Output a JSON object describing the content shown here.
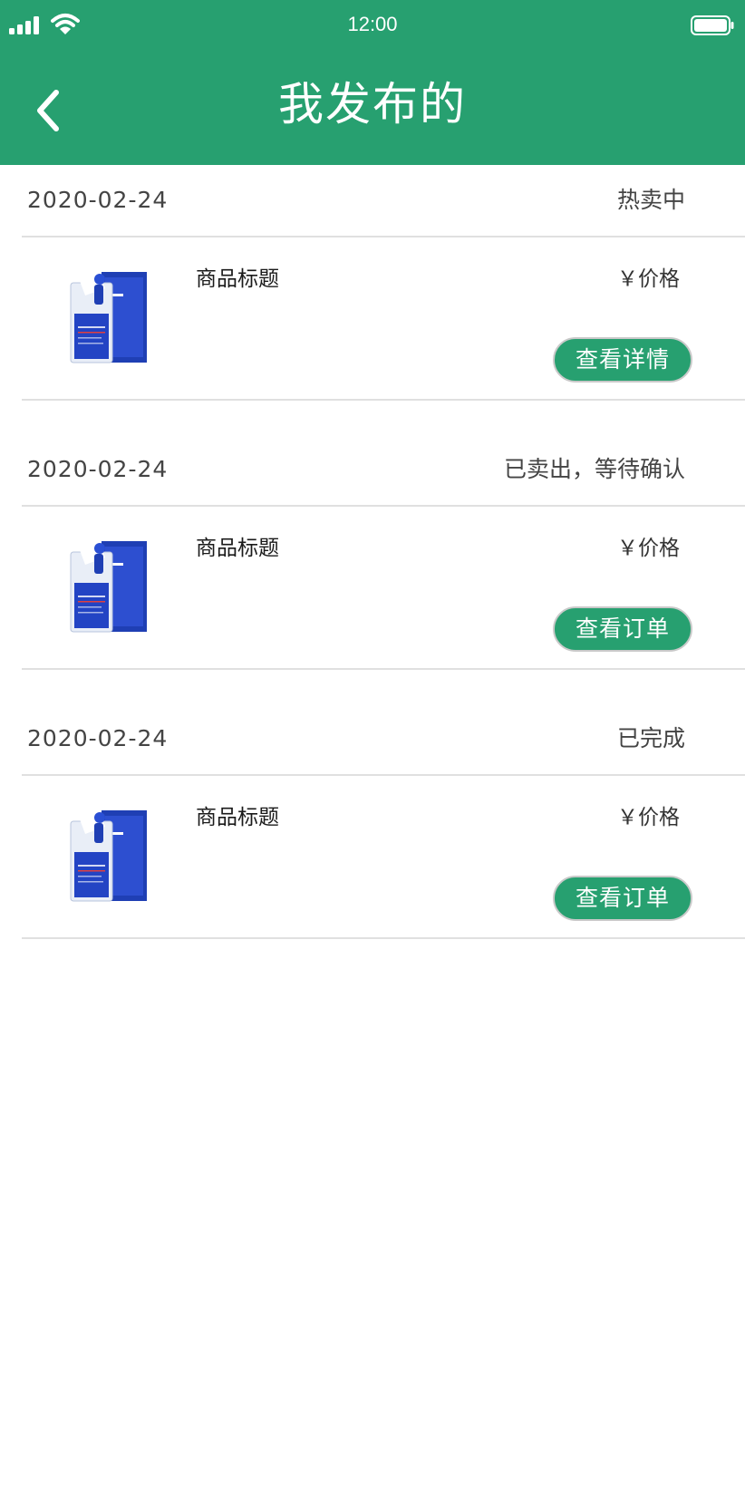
{
  "status_bar": {
    "time": "12:00",
    "signal_icon": "cellular-signal-icon",
    "wifi_icon": "wifi-icon",
    "battery_icon": "battery-icon"
  },
  "header": {
    "title": "我发布的",
    "back_icon": "chevron-left-icon",
    "background_color": "#27a070"
  },
  "listings": [
    {
      "date": "2020-02-24",
      "status": "热卖中",
      "product_title": "商品标题",
      "price": "￥价格",
      "action_label": "查看详情",
      "thumbnail_icon": "face-mask-product-icon"
    },
    {
      "date": "2020-02-24",
      "status": "已卖出，等待确认",
      "product_title": "商品标题",
      "price": "￥价格",
      "action_label": "查看订单",
      "thumbnail_icon": "face-mask-product-icon"
    },
    {
      "date": "2020-02-24",
      "status": "已完成",
      "product_title": "商品标题",
      "price": "￥价格",
      "action_label": "查看订单",
      "thumbnail_icon": "face-mask-product-icon"
    }
  ],
  "colors": {
    "accent": "#27a070",
    "divider": "#e0e0e0",
    "text_secondary": "#444444"
  }
}
